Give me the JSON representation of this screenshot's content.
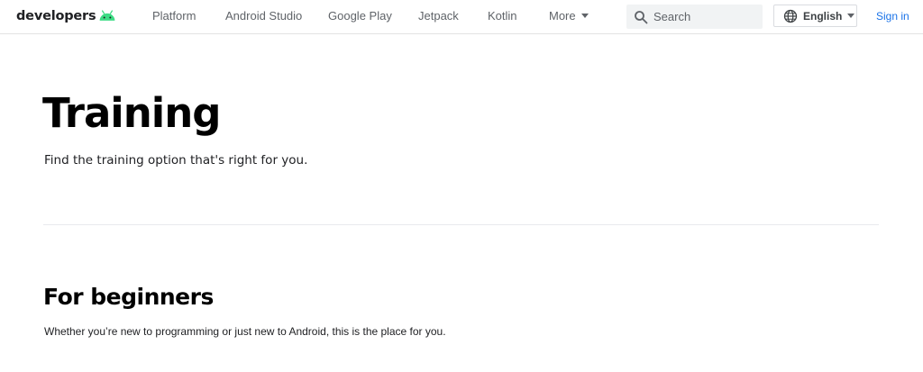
{
  "header": {
    "brand": {
      "text": "developers",
      "logo_icon": "android-head-icon",
      "logo_color": "#3ddc84"
    },
    "nav": [
      {
        "label": "Platform"
      },
      {
        "label": "Android Studio"
      },
      {
        "label": "Google Play"
      },
      {
        "label": "Jetpack"
      },
      {
        "label": "Kotlin"
      },
      {
        "label": "More",
        "icon": "caret-down-icon"
      }
    ],
    "search": {
      "placeholder": "Search",
      "icon": "search-icon"
    },
    "language": {
      "selected": "English",
      "icon": "globe-icon"
    },
    "sign_in": "Sign in",
    "link_color": "#1a73e8"
  },
  "main": {
    "title": "Training",
    "subtitle": "Find the training option that's right for you.",
    "sections": [
      {
        "heading": "For beginners",
        "text": "Whether you’re new to programming or just new to Android, this is the place for you."
      }
    ]
  }
}
